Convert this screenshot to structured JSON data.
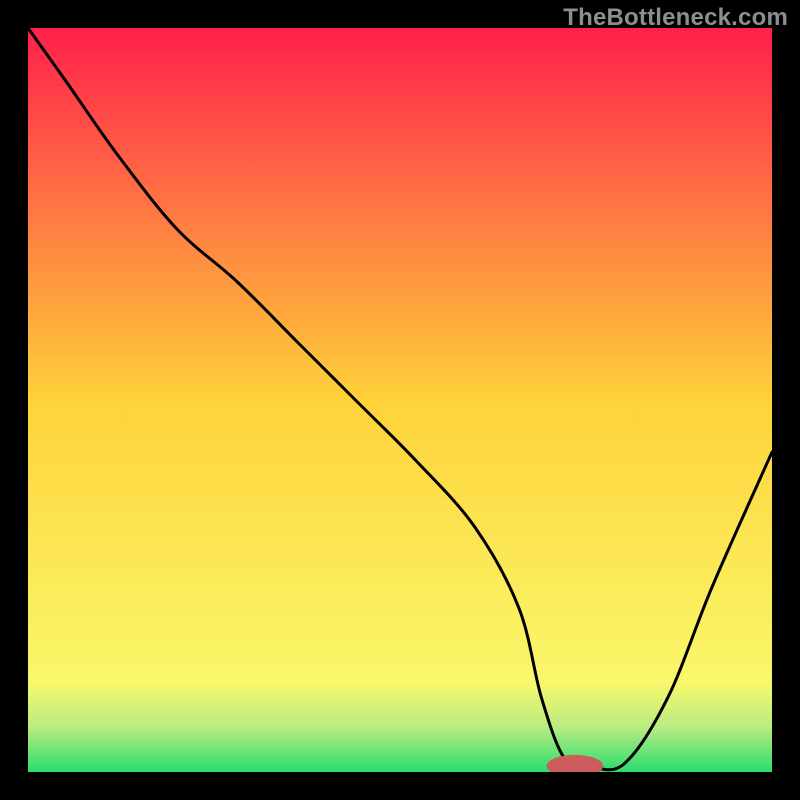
{
  "watermark": "TheBottleneck.com",
  "chart_data": {
    "type": "line",
    "title": "",
    "xlabel": "",
    "ylabel": "",
    "xlim": [
      0,
      100
    ],
    "ylim": [
      0,
      100
    ],
    "gradient_stops": [
      {
        "offset": 0,
        "color": "#ff1f4b"
      },
      {
        "offset": 50,
        "color": "#ffd23a"
      },
      {
        "offset": 88,
        "color": "#f9f86b"
      },
      {
        "offset": 94,
        "color": "#b8ec82"
      },
      {
        "offset": 100,
        "color": "#2bdc6e"
      }
    ],
    "series": [
      {
        "name": "bottleneck-curve",
        "x": [
          0,
          5,
          12,
          20,
          28,
          36,
          44,
          52,
          60,
          66,
          69,
          72,
          75,
          80,
          86,
          92,
          100
        ],
        "y": [
          100,
          93,
          83,
          73,
          66,
          58,
          50,
          42,
          33,
          22,
          10,
          2,
          1,
          1,
          10,
          25,
          43
        ]
      }
    ],
    "marker": {
      "name": "optimal-range",
      "cx": 73.5,
      "cy": 0.8,
      "rx": 3.8,
      "ry": 1.5,
      "color": "#cd5c5c"
    }
  }
}
